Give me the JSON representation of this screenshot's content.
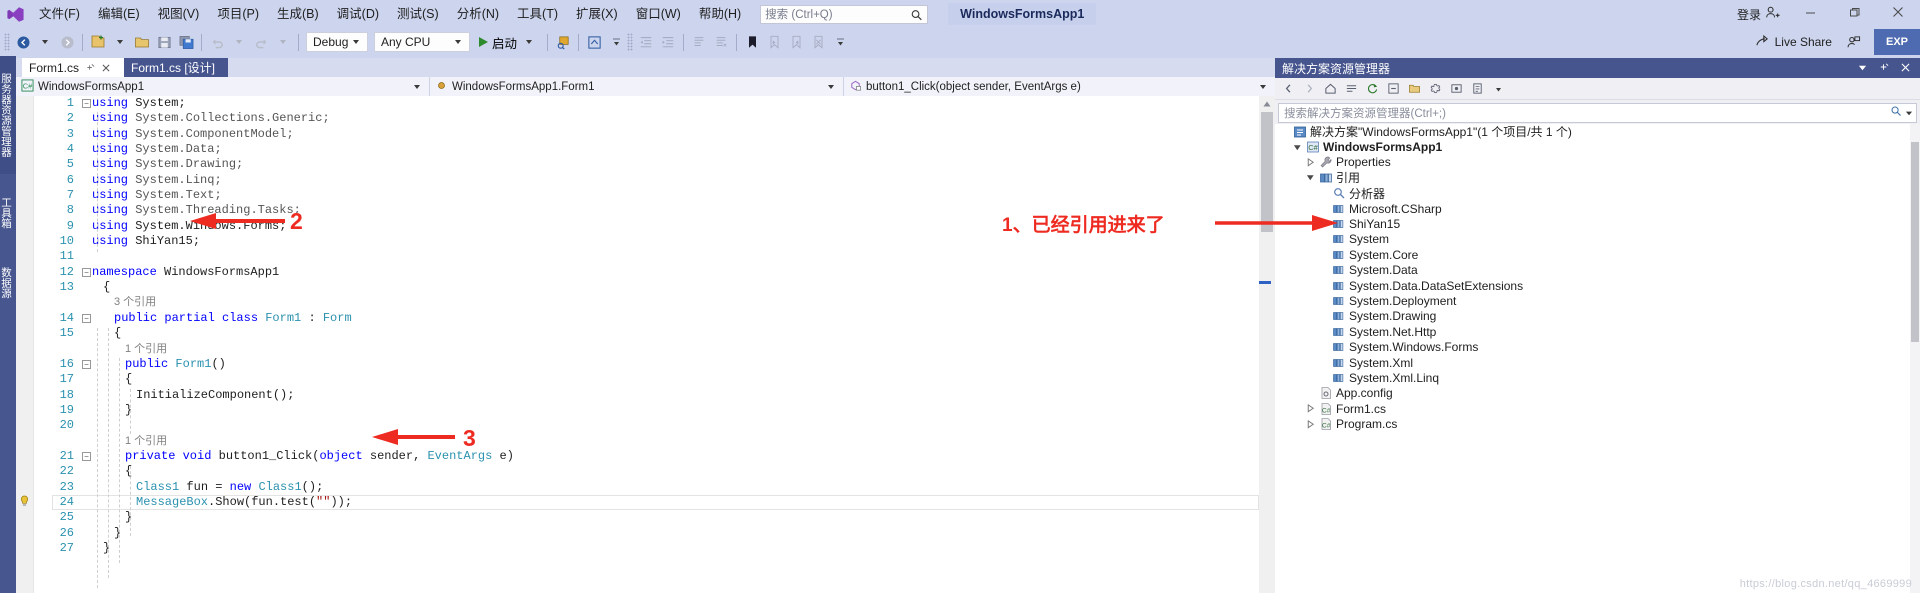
{
  "titlebar": {
    "logo_icon": "visual-studio-logo",
    "menus": [
      "文件(F)",
      "编辑(E)",
      "视图(V)",
      "项目(P)",
      "生成(B)",
      "调试(D)",
      "测试(S)",
      "分析(N)",
      "工具(T)",
      "扩展(X)",
      "窗口(W)",
      "帮助(H)"
    ],
    "search_placeholder": "搜索 (Ctrl+Q)",
    "search_icon": "search-icon",
    "project_chip": "WindowsFormsApp1",
    "signin_label": "登录",
    "signin_icon": "account-add-icon",
    "minimize_icon": "minimize-icon",
    "maximize_icon": "restore-icon",
    "close_icon": "close-icon"
  },
  "toolbar": {
    "back_icon": "navigate-back-icon",
    "forward_icon": "navigate-forward-icon",
    "new_project_icon": "new-project-icon",
    "open_icon": "open-file-icon",
    "save_icon": "save-icon",
    "save_all_icon": "save-all-icon",
    "undo_icon": "undo-icon",
    "redo_icon": "redo-icon",
    "config_value": "Debug",
    "platform_value": "Any CPU",
    "start_label": "启动",
    "start_icon": "play-icon",
    "attach_icon": "attach-process-icon",
    "frame_icon": "select-frame-icon",
    "indent_icons": [
      "decrease-indent-icon",
      "increase-indent-icon",
      "comment-icon",
      "uncomment-icon"
    ],
    "bookmark_icon": "bookmark-icon",
    "bookmark_nav_icons": [
      "next-bookmark-icon",
      "prev-bookmark-icon",
      "clear-bookmarks-icon"
    ],
    "overflow_icon": "toolbar-overflow-icon",
    "live_share_label": "Live Share",
    "live_share_icon": "live-share-icon",
    "feedback_icon": "send-feedback-icon",
    "exp_label": "EXP"
  },
  "left_tool_tabs": [
    {
      "label": "服务器资源管理器",
      "selected": false
    },
    {
      "label": "工具箱",
      "selected": false
    },
    {
      "label": "数据源",
      "selected": false
    }
  ],
  "document_tabs": [
    {
      "label": "Form1.cs",
      "active": true,
      "pin_icon": "pin-icon",
      "close_icon": "close-icon"
    },
    {
      "label": "Form1.cs [设计]",
      "active": false
    }
  ],
  "navbar": {
    "project": "WindowsFormsApp1",
    "project_icon": "csharp-project-icon",
    "type": "WindowsFormsApp1.Form1",
    "type_icon": "class-icon",
    "member": "button1_Click(object sender, EventArgs e)",
    "member_icon": "method-private-icon",
    "split_icon": "split-editor-icon",
    "settings_icon": "gear-icon"
  },
  "editor": {
    "lightbulb_icon": "lightbulb-icon",
    "lines": [
      {
        "n": "1",
        "indent": 0,
        "fold": "minus",
        "tokens": [
          {
            "t": "using ",
            "c": "kw"
          },
          {
            "t": "System",
            "c": "id"
          },
          {
            "t": ";",
            "c": "id"
          }
        ]
      },
      {
        "n": "2",
        "indent": 0,
        "tokens": [
          {
            "t": "using ",
            "c": "kw"
          },
          {
            "t": "System.Collections.Generic",
            "c": "ns"
          },
          {
            "t": ";",
            "c": "ns"
          }
        ]
      },
      {
        "n": "3",
        "indent": 0,
        "tokens": [
          {
            "t": "using ",
            "c": "kw"
          },
          {
            "t": "System.ComponentModel",
            "c": "ns"
          },
          {
            "t": ";",
            "c": "ns"
          }
        ]
      },
      {
        "n": "4",
        "indent": 0,
        "tokens": [
          {
            "t": "using ",
            "c": "kw"
          },
          {
            "t": "System.Data",
            "c": "ns"
          },
          {
            "t": ";",
            "c": "ns"
          }
        ]
      },
      {
        "n": "5",
        "indent": 0,
        "tokens": [
          {
            "t": "using ",
            "c": "kw"
          },
          {
            "t": "System.Drawing",
            "c": "ns"
          },
          {
            "t": ";",
            "c": "ns"
          }
        ]
      },
      {
        "n": "6",
        "indent": 0,
        "tokens": [
          {
            "t": "using ",
            "c": "kw"
          },
          {
            "t": "System.Linq",
            "c": "ns"
          },
          {
            "t": ";",
            "c": "ns"
          }
        ]
      },
      {
        "n": "7",
        "indent": 0,
        "tokens": [
          {
            "t": "using ",
            "c": "kw"
          },
          {
            "t": "System.Text",
            "c": "ns"
          },
          {
            "t": ";",
            "c": "ns"
          }
        ]
      },
      {
        "n": "8",
        "indent": 0,
        "tokens": [
          {
            "t": "using ",
            "c": "kw"
          },
          {
            "t": "System.Threading.Tasks",
            "c": "ns"
          },
          {
            "t": ";",
            "c": "ns"
          }
        ]
      },
      {
        "n": "9",
        "indent": 0,
        "tokens": [
          {
            "t": "using ",
            "c": "kw"
          },
          {
            "t": "System.Windows.Forms",
            "c": "id"
          },
          {
            "t": ";",
            "c": "id"
          }
        ]
      },
      {
        "n": "10",
        "indent": 0,
        "tokens": [
          {
            "t": "using ",
            "c": "kw"
          },
          {
            "t": "ShiYan15",
            "c": "id"
          },
          {
            "t": ";",
            "c": "id"
          }
        ]
      },
      {
        "n": "11",
        "indent": 0,
        "tokens": []
      },
      {
        "n": "12",
        "indent": 0,
        "fold": "minus",
        "tokens": [
          {
            "t": "namespace ",
            "c": "kw"
          },
          {
            "t": "WindowsFormsApp1",
            "c": "id"
          }
        ]
      },
      {
        "n": "13",
        "indent": 1,
        "tokens": [
          {
            "t": "{",
            "c": "id"
          }
        ]
      },
      {
        "n": "",
        "indent": 2,
        "tokens": [
          {
            "t": "3 个引用",
            "c": "ref"
          }
        ]
      },
      {
        "n": "14",
        "indent": 2,
        "fold": "minus",
        "tokens": [
          {
            "t": "public partial class ",
            "c": "kw"
          },
          {
            "t": "Form1",
            "c": "type"
          },
          {
            "t": " : ",
            "c": "id"
          },
          {
            "t": "Form",
            "c": "type"
          }
        ]
      },
      {
        "n": "15",
        "indent": 2,
        "tokens": [
          {
            "t": "{",
            "c": "id"
          }
        ]
      },
      {
        "n": "",
        "indent": 3,
        "tokens": [
          {
            "t": "1 个引用",
            "c": "ref"
          }
        ]
      },
      {
        "n": "16",
        "indent": 3,
        "fold": "minus",
        "tokens": [
          {
            "t": "public ",
            "c": "kw"
          },
          {
            "t": "Form1",
            "c": "type"
          },
          {
            "t": "()",
            "c": "id"
          }
        ]
      },
      {
        "n": "17",
        "indent": 3,
        "tokens": [
          {
            "t": "{",
            "c": "id"
          }
        ]
      },
      {
        "n": "18",
        "indent": 4,
        "tokens": [
          {
            "t": "InitializeComponent",
            "c": "id"
          },
          {
            "t": "();",
            "c": "id"
          }
        ]
      },
      {
        "n": "19",
        "indent": 3,
        "tokens": [
          {
            "t": "}",
            "c": "id"
          }
        ]
      },
      {
        "n": "20",
        "indent": 0,
        "tokens": []
      },
      {
        "n": "",
        "indent": 3,
        "tokens": [
          {
            "t": "1 个引用",
            "c": "ref"
          }
        ]
      },
      {
        "n": "21",
        "indent": 3,
        "fold": "minus",
        "tokens": [
          {
            "t": "private void ",
            "c": "kw"
          },
          {
            "t": "button1_Click",
            "c": "id"
          },
          {
            "t": "(",
            "c": "id"
          },
          {
            "t": "object",
            "c": "kw"
          },
          {
            "t": " sender, ",
            "c": "id"
          },
          {
            "t": "EventArgs",
            "c": "type"
          },
          {
            "t": " e)",
            "c": "id"
          }
        ]
      },
      {
        "n": "22",
        "indent": 3,
        "tokens": [
          {
            "t": "{",
            "c": "id"
          }
        ]
      },
      {
        "n": "23",
        "indent": 4,
        "tokens": [
          {
            "t": "Class1",
            "c": "type"
          },
          {
            "t": " fun = ",
            "c": "id"
          },
          {
            "t": "new ",
            "c": "kw"
          },
          {
            "t": "Class1",
            "c": "type"
          },
          {
            "t": "();",
            "c": "id"
          }
        ]
      },
      {
        "n": "24",
        "indent": 4,
        "cursor": true,
        "bulb": true,
        "tokens": [
          {
            "t": "MessageBox",
            "c": "type"
          },
          {
            "t": ".Show(fun.test(",
            "c": "id"
          },
          {
            "t": "\"\"",
            "c": "str"
          },
          {
            "t": "));",
            "c": "id"
          }
        ]
      },
      {
        "n": "25",
        "indent": 3,
        "tokens": [
          {
            "t": "}",
            "c": "id"
          }
        ]
      },
      {
        "n": "26",
        "indent": 2,
        "tokens": [
          {
            "t": "}",
            "c": "id"
          }
        ]
      },
      {
        "n": "27",
        "indent": 1,
        "tokens": [
          {
            "t": "}",
            "c": "id"
          }
        ]
      }
    ]
  },
  "solution_explorer": {
    "title": "解决方案资源管理器",
    "title_dropdown_icon": "chevron-down-icon",
    "title_pin_icon": "pin-icon",
    "title_close_icon": "close-icon",
    "toolbar_icons": [
      "back-icon",
      "forward-icon",
      "home-icon",
      "collapse-all-icon",
      "refresh-icon",
      "show-all-files-icon",
      "properties-icon",
      "preview-selected-icon",
      "pending-changes-icon",
      "switch-views-icon"
    ],
    "search_placeholder": "搜索解决方案资源管理器(Ctrl+;)",
    "search_icon": "search-icon",
    "search_dropdown_icon": "chevron-down-icon",
    "tree": [
      {
        "depth": 0,
        "label": "解决方案\"WindowsFormsApp1\"(1 个项目/共 1 个)",
        "icon": "solution-icon",
        "twisty": "",
        "bold": false
      },
      {
        "depth": 1,
        "label": "WindowsFormsApp1",
        "icon": "csharp-project-icon",
        "twisty": "expanded",
        "bold": true
      },
      {
        "depth": 2,
        "label": "Properties",
        "icon": "wrench-icon",
        "twisty": "collapsed",
        "bold": false
      },
      {
        "depth": 2,
        "label": "引用",
        "icon": "references-icon",
        "twisty": "expanded",
        "bold": false
      },
      {
        "depth": 3,
        "label": "分析器",
        "icon": "analyzers-icon",
        "twisty": "",
        "bold": false
      },
      {
        "depth": 3,
        "label": "Microsoft.CSharp",
        "icon": "reference-icon",
        "twisty": "",
        "bold": false
      },
      {
        "depth": 3,
        "label": "ShiYan15",
        "icon": "reference-icon",
        "twisty": "",
        "bold": false
      },
      {
        "depth": 3,
        "label": "System",
        "icon": "reference-icon",
        "twisty": "",
        "bold": false
      },
      {
        "depth": 3,
        "label": "System.Core",
        "icon": "reference-icon",
        "twisty": "",
        "bold": false
      },
      {
        "depth": 3,
        "label": "System.Data",
        "icon": "reference-icon",
        "twisty": "",
        "bold": false
      },
      {
        "depth": 3,
        "label": "System.Data.DataSetExtensions",
        "icon": "reference-icon",
        "twisty": "",
        "bold": false
      },
      {
        "depth": 3,
        "label": "System.Deployment",
        "icon": "reference-icon",
        "twisty": "",
        "bold": false
      },
      {
        "depth": 3,
        "label": "System.Drawing",
        "icon": "reference-icon",
        "twisty": "",
        "bold": false
      },
      {
        "depth": 3,
        "label": "System.Net.Http",
        "icon": "reference-icon",
        "twisty": "",
        "bold": false
      },
      {
        "depth": 3,
        "label": "System.Windows.Forms",
        "icon": "reference-icon",
        "twisty": "",
        "bold": false
      },
      {
        "depth": 3,
        "label": "System.Xml",
        "icon": "reference-icon",
        "twisty": "",
        "bold": false
      },
      {
        "depth": 3,
        "label": "System.Xml.Linq",
        "icon": "reference-icon",
        "twisty": "",
        "bold": false
      },
      {
        "depth": 2,
        "label": "App.config",
        "icon": "config-file-icon",
        "twisty": "",
        "bold": false
      },
      {
        "depth": 2,
        "label": "Form1.cs",
        "icon": "csharp-file-icon",
        "twisty": "collapsed",
        "bold": false
      },
      {
        "depth": 2,
        "label": "Program.cs",
        "icon": "csharp-file-icon",
        "twisty": "collapsed",
        "bold": false
      }
    ]
  },
  "annotations": {
    "color": "#ee2b21",
    "items": [
      {
        "id": "anno-1",
        "text": "1、已经引用进来了"
      },
      {
        "id": "anno-2",
        "text": "2"
      },
      {
        "id": "anno-3",
        "text": "3"
      }
    ]
  },
  "watermark": "https://blog.csdn.net/qq_4669999"
}
